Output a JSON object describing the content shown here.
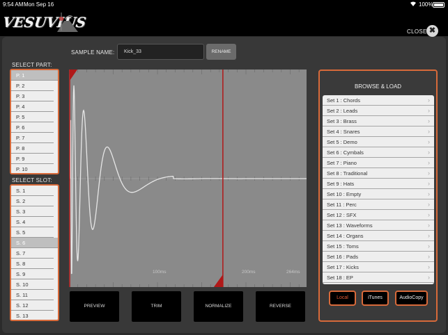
{
  "status": {
    "time": "9:54 AM",
    "date": "Mon Sep 16",
    "battery": "100%",
    "wifi_icon": "wifi-icon"
  },
  "header": {
    "logo": "VESUVIUS",
    "close_label": "CLOSE",
    "close_icon": "✖"
  },
  "sample": {
    "name_label": "SAMPLE NAME:",
    "name_value": "Kick_33",
    "rename_label": "RENAME"
  },
  "parts": {
    "label": "SELECT PART:",
    "selected_index": 0,
    "items": [
      "P. 1",
      "P. 2",
      "P. 3",
      "P. 4",
      "P. 5",
      "P. 6",
      "P. 7",
      "P. 8",
      "P. 9",
      "P. 10"
    ]
  },
  "slots": {
    "label": "SELECT SLOT:",
    "selected_index": 5,
    "items": [
      "S. 1",
      "S. 2",
      "S. 3",
      "S. 4",
      "S. 5",
      "S. 6",
      "S. 7",
      "S. 8",
      "S. 9",
      "S. 10",
      "S. 11",
      "S. 12",
      "S. 13"
    ]
  },
  "waveform": {
    "time_labels": [
      "100ms",
      "200ms",
      "264ms"
    ],
    "trim_start_ms": 0,
    "trim_end_ms": 190,
    "duration_ms": 264
  },
  "actions": [
    "PREVIEW",
    "TRIM",
    "NORMALIZE",
    "REVERSE"
  ],
  "browse": {
    "title": "BROWSE & LOAD",
    "sets": [
      "Set 1 : Chords",
      "Set 2 : Leads",
      "Set 3 : Brass",
      "Set 4 : Snares",
      "Set 5 : Demo",
      "Set 6 : Cymbals",
      "Set 7 : Piano",
      "Set 8 : Traditional",
      "Set 9 : Hats",
      "Set 10 : Empty",
      "Set 11 : Perc",
      "Set 12 : SFX",
      "Set 13 : Waveforms",
      "Set 14 : Organs",
      "Set 15 : Toms",
      "Set 16 : Pads",
      "Set 17 : Kicks",
      "Set 18 : EP"
    ],
    "sources": [
      "Local",
      "iTunes",
      "AudioCopy"
    ],
    "active_source": 0
  },
  "colors": {
    "accent": "#d86a3a",
    "trim_marker": "#b01818"
  }
}
